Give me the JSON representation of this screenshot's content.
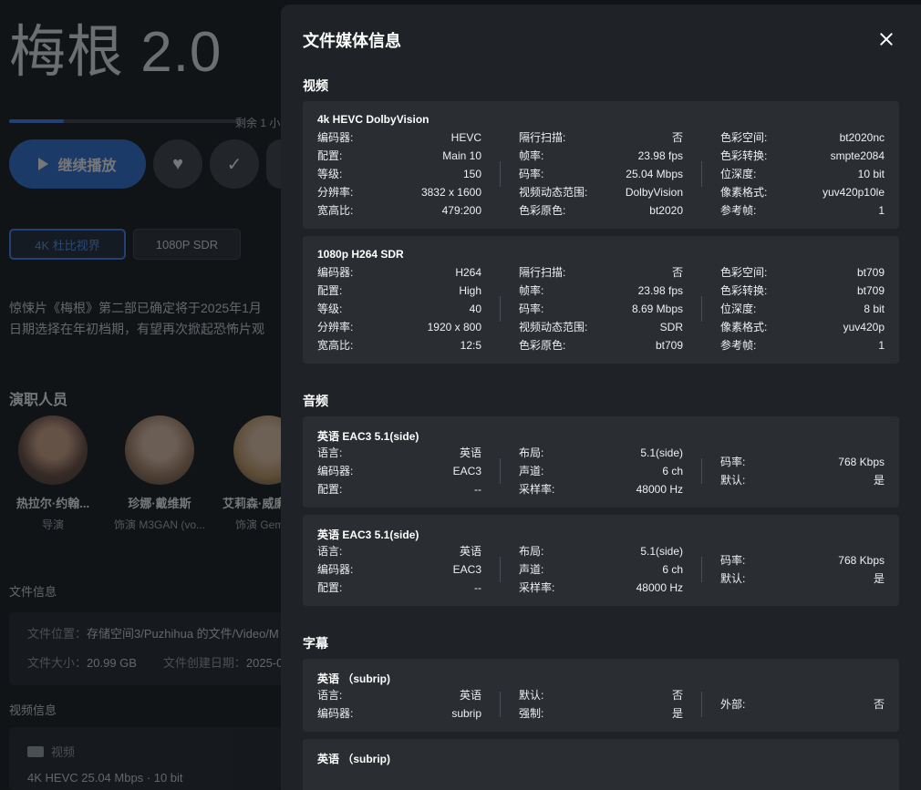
{
  "background": {
    "title": "梅根 2.0",
    "remaining": "剩余 1 小",
    "play_label": "继续播放",
    "version_chips": [
      "4K 杜比视界",
      "1080P SDR"
    ],
    "description": [
      "惊悚片《梅根》第二部已确定将于2025年1月",
      "日期选择在年初档期，有望再次掀起恐怖片观"
    ],
    "cast_heading": "演职人员",
    "cast": [
      {
        "name": "热拉尔·约翰...",
        "role": "导演"
      },
      {
        "name": "珍娜·戴维斯",
        "role": "饰演 M3GAN (vo..."
      },
      {
        "name": "艾莉森·威廉",
        "role": "饰演 Gem"
      }
    ],
    "file_info_heading": "文件信息",
    "file_location_label": "文件位置：",
    "file_location_value": "存储空间3/Puzhihua 的文件/Video/M",
    "file_size_label": "文件大小：",
    "file_size_value": "20.99 GB",
    "file_date_label": "文件创建日期：",
    "file_date_value": "2025-0",
    "video_info_heading": "视频信息",
    "video_label": "视频",
    "video_summary": "4K HEVC 25.04 Mbps · 10 bit",
    "progress_fraction": 0.24
  },
  "modal": {
    "title": "文件媒体信息",
    "video_heading": "视频",
    "audio_heading": "音频",
    "subtitle_heading": "字幕",
    "video_tracks": [
      {
        "name": "4k HEVC DolbyVision",
        "col1": [
          [
            "编码器:",
            "HEVC"
          ],
          [
            "配置:",
            "Main 10"
          ],
          [
            "等级:",
            "150"
          ],
          [
            "分辨率:",
            "3832 x 1600"
          ],
          [
            "宽高比:",
            "479:200"
          ]
        ],
        "col2": [
          [
            "隔行扫描:",
            "否"
          ],
          [
            "帧率:",
            "23.98 fps"
          ],
          [
            "码率:",
            "25.04 Mbps"
          ],
          [
            "视频动态范围:",
            "DolbyVision"
          ],
          [
            "色彩原色:",
            "bt2020"
          ]
        ],
        "col3": [
          [
            "色彩空间:",
            "bt2020nc"
          ],
          [
            "色彩转换:",
            "smpte2084"
          ],
          [
            "位深度:",
            "10 bit"
          ],
          [
            "像素格式:",
            "yuv420p10le"
          ],
          [
            "参考帧:",
            "1"
          ]
        ]
      },
      {
        "name": "1080p H264 SDR",
        "col1": [
          [
            "编码器:",
            "H264"
          ],
          [
            "配置:",
            "High"
          ],
          [
            "等级:",
            "40"
          ],
          [
            "分辨率:",
            "1920 x 800"
          ],
          [
            "宽高比:",
            "12:5"
          ]
        ],
        "col2": [
          [
            "隔行扫描:",
            "否"
          ],
          [
            "帧率:",
            "23.98 fps"
          ],
          [
            "码率:",
            "8.69 Mbps"
          ],
          [
            "视频动态范围:",
            "SDR"
          ],
          [
            "色彩原色:",
            "bt709"
          ]
        ],
        "col3": [
          [
            "色彩空间:",
            "bt709"
          ],
          [
            "色彩转换:",
            "bt709"
          ],
          [
            "位深度:",
            "8 bit"
          ],
          [
            "像素格式:",
            "yuv420p"
          ],
          [
            "参考帧:",
            "1"
          ]
        ]
      }
    ],
    "audio_tracks": [
      {
        "name": "英语 EAC3 5.1(side)",
        "col1": [
          [
            "语言:",
            "英语"
          ],
          [
            "编码器:",
            "EAC3"
          ],
          [
            "配置:",
            "--"
          ]
        ],
        "col2": [
          [
            "布局:",
            "5.1(side)"
          ],
          [
            "声道:",
            "6 ch"
          ],
          [
            "采样率:",
            "48000 Hz"
          ]
        ],
        "col3": [
          [
            "码率:",
            "768 Kbps"
          ],
          [
            "默认:",
            "是"
          ]
        ]
      },
      {
        "name": "英语 EAC3 5.1(side)",
        "col1": [
          [
            "语言:",
            "英语"
          ],
          [
            "编码器:",
            "EAC3"
          ],
          [
            "配置:",
            "--"
          ]
        ],
        "col2": [
          [
            "布局:",
            "5.1(side)"
          ],
          [
            "声道:",
            "6 ch"
          ],
          [
            "采样率:",
            "48000 Hz"
          ]
        ],
        "col3": [
          [
            "码率:",
            "768 Kbps"
          ],
          [
            "默认:",
            "是"
          ]
        ]
      }
    ],
    "subtitle_tracks": [
      {
        "name": "英语 （subrip)",
        "col1": [
          [
            "语言:",
            "英语"
          ],
          [
            "编码器:",
            "subrip"
          ]
        ],
        "col2": [
          [
            "默认:",
            "否"
          ],
          [
            "强制:",
            "是"
          ]
        ],
        "col3": [
          [
            "外部:",
            "否"
          ]
        ]
      },
      {
        "name": "英语 （subrip)",
        "col1": [],
        "col2": [],
        "col3": []
      }
    ]
  }
}
